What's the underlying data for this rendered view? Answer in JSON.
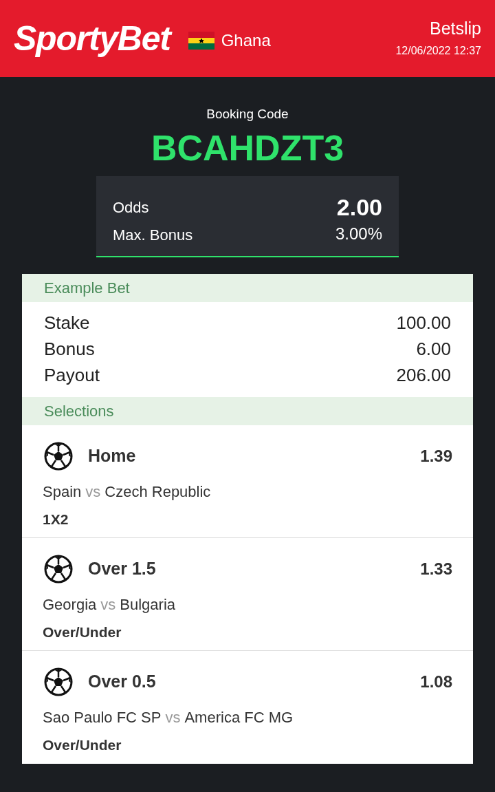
{
  "header": {
    "logo": "SportyBet",
    "country": "Ghana",
    "title": "Betslip",
    "datetime": "12/06/2022 12:37"
  },
  "booking": {
    "label": "Booking Code",
    "code": "BCAHDZT3"
  },
  "summary": [
    {
      "label": "Odds",
      "value": "2.00",
      "emphasis": true
    },
    {
      "label": "Max. Bonus",
      "value": "3.00%",
      "emphasis": false
    }
  ],
  "example_bet": {
    "heading": "Example Bet",
    "rows": [
      {
        "label": "Stake",
        "value": "100.00"
      },
      {
        "label": "Bonus",
        "value": "6.00"
      },
      {
        "label": "Payout",
        "value": "206.00"
      }
    ]
  },
  "selections": {
    "heading": "Selections",
    "items": [
      {
        "pick": "Home",
        "odds": "1.39",
        "home": "Spain",
        "separator": "vs",
        "away": "Czech Republic",
        "market": "1X2"
      },
      {
        "pick": "Over 1.5",
        "odds": "1.33",
        "home": "Georgia",
        "separator": "vs",
        "away": "Bulgaria",
        "market": "Over/Under"
      },
      {
        "pick": "Over 0.5",
        "odds": "1.08",
        "home": "Sao Paulo FC SP",
        "separator": "vs",
        "away": "America FC MG",
        "market": "Over/Under"
      }
    ]
  }
}
